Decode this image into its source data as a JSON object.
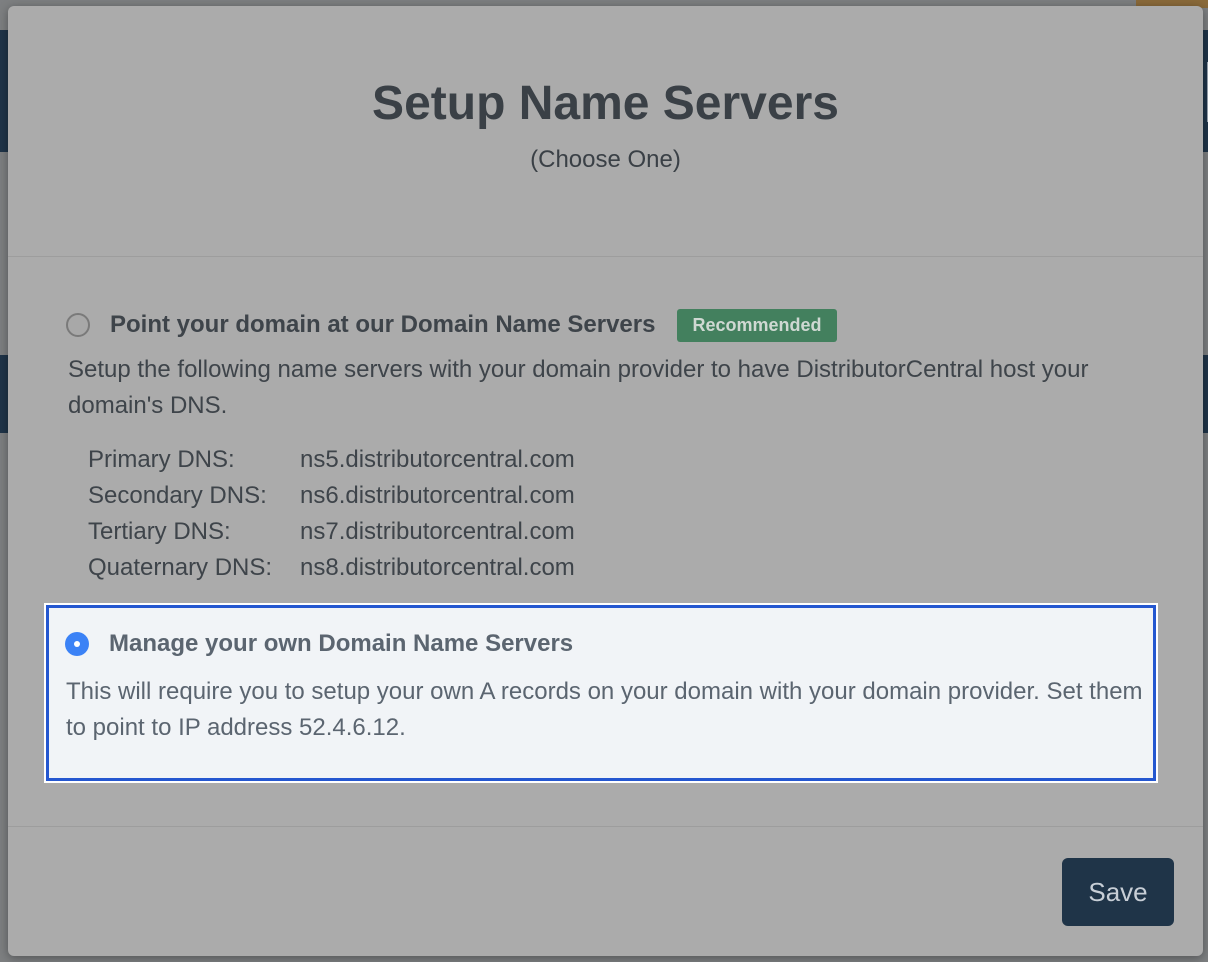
{
  "dialog": {
    "title": "Setup Name Servers",
    "subtitle": "(Choose One)"
  },
  "options": [
    {
      "label": "Point your domain at our Domain Name Servers",
      "badge": "Recommended",
      "description": "Setup the following name servers with your domain provider to have DistributorCentral host your domain's DNS.",
      "selected": false,
      "dns": [
        {
          "label": "Primary DNS:",
          "value": "ns5.distributorcentral.com"
        },
        {
          "label": "Secondary DNS:",
          "value": "ns6.distributorcentral.com"
        },
        {
          "label": "Tertiary DNS:",
          "value": "ns7.distributorcentral.com"
        },
        {
          "label": "Quaternary DNS:",
          "value": "ns8.distributorcentral.com"
        }
      ]
    },
    {
      "label": "Manage your own Domain Name Servers",
      "description": "This will require you to setup your own A records on your domain with your domain provider. Set them to point to IP address 52.4.6.12.",
      "selected": true
    }
  ],
  "footer": {
    "save_label": "Save"
  },
  "colors": {
    "accent": "#3b82f6",
    "selection_border": "#2457d0",
    "badge_bg": "#43805e",
    "button_bg": "#1f3448"
  }
}
